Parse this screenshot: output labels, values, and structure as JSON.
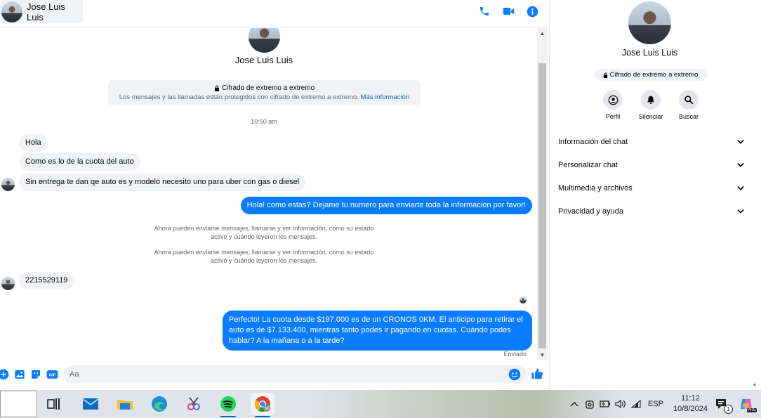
{
  "contact": {
    "name": "Jose Luis Luis"
  },
  "header_icons": [
    "phone-icon",
    "video-icon",
    "info-icon"
  ],
  "encryption": {
    "title": "Cifrado de extremo a extremo",
    "description": "Los mensajes y las llamadas están protegidos con cifrado de extremo a extremo.",
    "link": "Más información"
  },
  "timestamp": "10:50 am",
  "messages": {
    "m1": "Hola",
    "m2": "Como es lo de la cuota del auto",
    "m3": "Sin entrega te dan qe auto es y modelo necesito uno para uber con gas o diesel",
    "m4": "Hola! como estas? Dejame tu numero para enviarte toda la informacion por favor!",
    "sys1": "Ahora pueden enviarse mensajes, llamarse y ver información, como su estado activo y cuándo leyeron los mensajes.",
    "sys2": "Ahora pueden enviarse mensajes, llamarse y ver información, como su estado activo y cuándo leyeron los mensajes.",
    "m5": "2215529119",
    "m6": "Perfecto! La cuota desde $197.000 es de un CRONOS 0KM. El anticipo para retirar el auto es de $7.133.400, mientras tanto podes ir pagando en cuotas. Cuándo podes hablar? A la mañana o a la tarde?",
    "sent_status": "Enviado"
  },
  "composer": {
    "placeholder": "Aa"
  },
  "right_panel": {
    "name": "Jose Luis Luis",
    "encryption": "Cifrado de extremo a extremo",
    "actions": {
      "profile": "Perfil",
      "mute": "Silenciar",
      "search": "Buscar"
    },
    "sections": {
      "s1": "Información del chat",
      "s2": "Personalizar chat",
      "s3": "Multimedia y archivos",
      "s4": "Privacidad y ayuda"
    }
  },
  "taskbar": {
    "language": "ESP",
    "time": "11:12",
    "date": "10/8/2024",
    "notification_count": "1",
    "copilot_badge": "PRE"
  },
  "colors": {
    "accent": "#0a7cff",
    "bubble_in": "#f0f2f5"
  }
}
